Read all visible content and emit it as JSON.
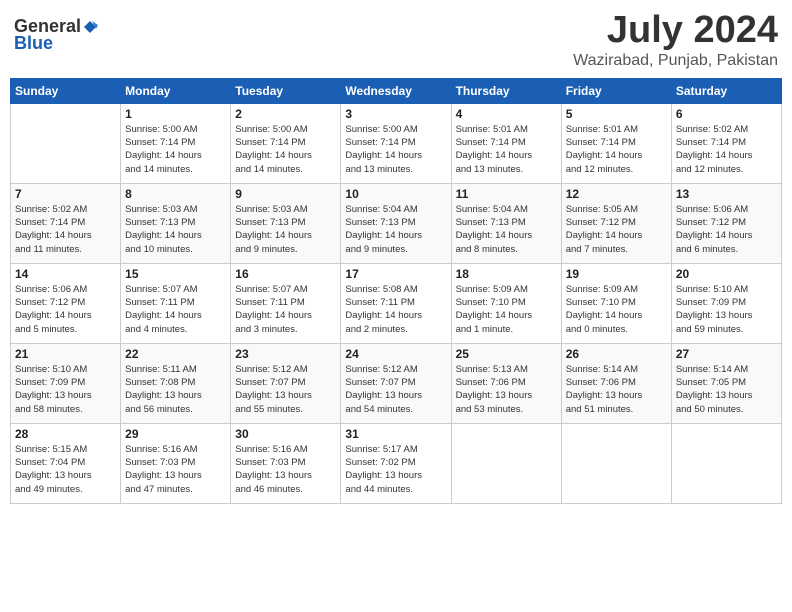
{
  "header": {
    "logo_general": "General",
    "logo_blue": "Blue",
    "month_year": "July 2024",
    "location": "Wazirabad, Punjab, Pakistan"
  },
  "weekdays": [
    "Sunday",
    "Monday",
    "Tuesday",
    "Wednesday",
    "Thursday",
    "Friday",
    "Saturday"
  ],
  "weeks": [
    [
      {
        "day": "",
        "content": ""
      },
      {
        "day": "1",
        "content": "Sunrise: 5:00 AM\nSunset: 7:14 PM\nDaylight: 14 hours\nand 14 minutes."
      },
      {
        "day": "2",
        "content": "Sunrise: 5:00 AM\nSunset: 7:14 PM\nDaylight: 14 hours\nand 14 minutes."
      },
      {
        "day": "3",
        "content": "Sunrise: 5:00 AM\nSunset: 7:14 PM\nDaylight: 14 hours\nand 13 minutes."
      },
      {
        "day": "4",
        "content": "Sunrise: 5:01 AM\nSunset: 7:14 PM\nDaylight: 14 hours\nand 13 minutes."
      },
      {
        "day": "5",
        "content": "Sunrise: 5:01 AM\nSunset: 7:14 PM\nDaylight: 14 hours\nand 12 minutes."
      },
      {
        "day": "6",
        "content": "Sunrise: 5:02 AM\nSunset: 7:14 PM\nDaylight: 14 hours\nand 12 minutes."
      }
    ],
    [
      {
        "day": "7",
        "content": "Sunrise: 5:02 AM\nSunset: 7:14 PM\nDaylight: 14 hours\nand 11 minutes."
      },
      {
        "day": "8",
        "content": "Sunrise: 5:03 AM\nSunset: 7:13 PM\nDaylight: 14 hours\nand 10 minutes."
      },
      {
        "day": "9",
        "content": "Sunrise: 5:03 AM\nSunset: 7:13 PM\nDaylight: 14 hours\nand 9 minutes."
      },
      {
        "day": "10",
        "content": "Sunrise: 5:04 AM\nSunset: 7:13 PM\nDaylight: 14 hours\nand 9 minutes."
      },
      {
        "day": "11",
        "content": "Sunrise: 5:04 AM\nSunset: 7:13 PM\nDaylight: 14 hours\nand 8 minutes."
      },
      {
        "day": "12",
        "content": "Sunrise: 5:05 AM\nSunset: 7:12 PM\nDaylight: 14 hours\nand 7 minutes."
      },
      {
        "day": "13",
        "content": "Sunrise: 5:06 AM\nSunset: 7:12 PM\nDaylight: 14 hours\nand 6 minutes."
      }
    ],
    [
      {
        "day": "14",
        "content": "Sunrise: 5:06 AM\nSunset: 7:12 PM\nDaylight: 14 hours\nand 5 minutes."
      },
      {
        "day": "15",
        "content": "Sunrise: 5:07 AM\nSunset: 7:11 PM\nDaylight: 14 hours\nand 4 minutes."
      },
      {
        "day": "16",
        "content": "Sunrise: 5:07 AM\nSunset: 7:11 PM\nDaylight: 14 hours\nand 3 minutes."
      },
      {
        "day": "17",
        "content": "Sunrise: 5:08 AM\nSunset: 7:11 PM\nDaylight: 14 hours\nand 2 minutes."
      },
      {
        "day": "18",
        "content": "Sunrise: 5:09 AM\nSunset: 7:10 PM\nDaylight: 14 hours\nand 1 minute."
      },
      {
        "day": "19",
        "content": "Sunrise: 5:09 AM\nSunset: 7:10 PM\nDaylight: 14 hours\nand 0 minutes."
      },
      {
        "day": "20",
        "content": "Sunrise: 5:10 AM\nSunset: 7:09 PM\nDaylight: 13 hours\nand 59 minutes."
      }
    ],
    [
      {
        "day": "21",
        "content": "Sunrise: 5:10 AM\nSunset: 7:09 PM\nDaylight: 13 hours\nand 58 minutes."
      },
      {
        "day": "22",
        "content": "Sunrise: 5:11 AM\nSunset: 7:08 PM\nDaylight: 13 hours\nand 56 minutes."
      },
      {
        "day": "23",
        "content": "Sunrise: 5:12 AM\nSunset: 7:07 PM\nDaylight: 13 hours\nand 55 minutes."
      },
      {
        "day": "24",
        "content": "Sunrise: 5:12 AM\nSunset: 7:07 PM\nDaylight: 13 hours\nand 54 minutes."
      },
      {
        "day": "25",
        "content": "Sunrise: 5:13 AM\nSunset: 7:06 PM\nDaylight: 13 hours\nand 53 minutes."
      },
      {
        "day": "26",
        "content": "Sunrise: 5:14 AM\nSunset: 7:06 PM\nDaylight: 13 hours\nand 51 minutes."
      },
      {
        "day": "27",
        "content": "Sunrise: 5:14 AM\nSunset: 7:05 PM\nDaylight: 13 hours\nand 50 minutes."
      }
    ],
    [
      {
        "day": "28",
        "content": "Sunrise: 5:15 AM\nSunset: 7:04 PM\nDaylight: 13 hours\nand 49 minutes."
      },
      {
        "day": "29",
        "content": "Sunrise: 5:16 AM\nSunset: 7:03 PM\nDaylight: 13 hours\nand 47 minutes."
      },
      {
        "day": "30",
        "content": "Sunrise: 5:16 AM\nSunset: 7:03 PM\nDaylight: 13 hours\nand 46 minutes."
      },
      {
        "day": "31",
        "content": "Sunrise: 5:17 AM\nSunset: 7:02 PM\nDaylight: 13 hours\nand 44 minutes."
      },
      {
        "day": "",
        "content": ""
      },
      {
        "day": "",
        "content": ""
      },
      {
        "day": "",
        "content": ""
      }
    ]
  ]
}
